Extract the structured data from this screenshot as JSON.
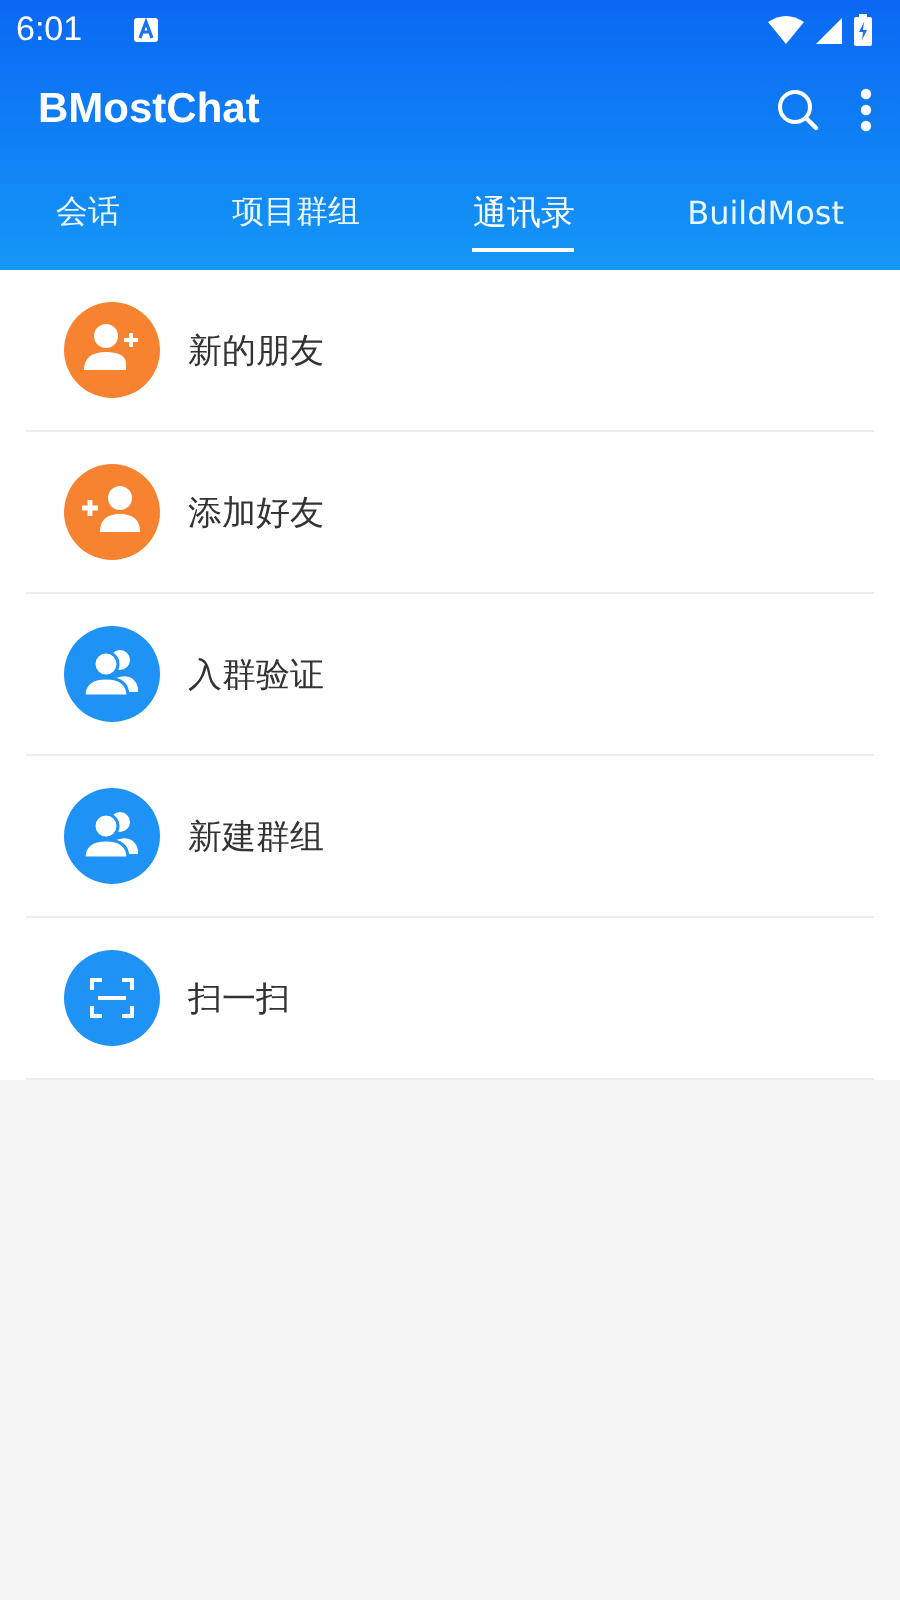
{
  "status_bar": {
    "time": "6:01"
  },
  "app_bar": {
    "title": "BMostChat"
  },
  "tabs": [
    {
      "label": "会话",
      "selected": false
    },
    {
      "label": "项目群组",
      "selected": false
    },
    {
      "label": "通讯录",
      "selected": true
    },
    {
      "label": "BuildMost",
      "selected": false
    }
  ],
  "items": [
    {
      "label": "新的朋友",
      "kind": "new-friend",
      "color": "#f7822f"
    },
    {
      "label": "添加好友",
      "kind": "add-friend",
      "color": "#f7822f"
    },
    {
      "label": "入群验证",
      "kind": "group",
      "color": "#1f92f5"
    },
    {
      "label": "新建群组",
      "kind": "group",
      "color": "#1f92f5"
    },
    {
      "label": "扫一扫",
      "kind": "scan",
      "color": "#1f92f5"
    }
  ]
}
